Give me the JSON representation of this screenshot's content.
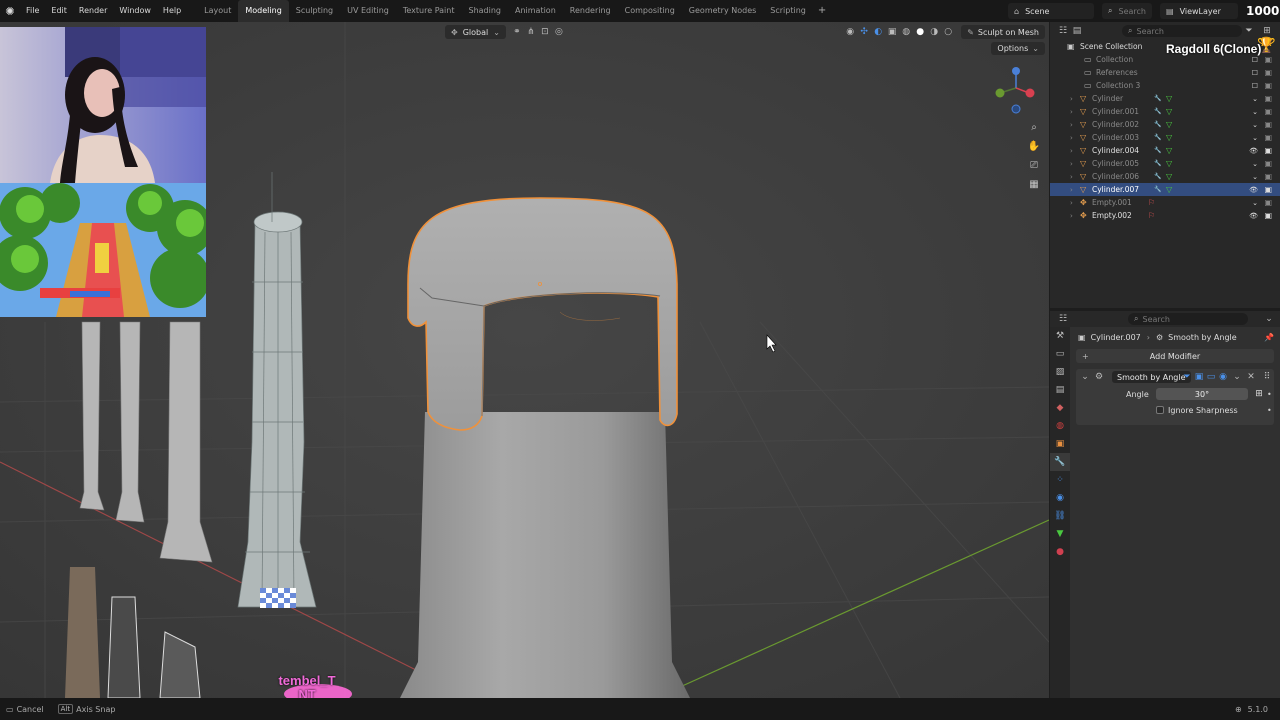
{
  "menu": {
    "items": [
      "File",
      "Edit",
      "Render",
      "Window",
      "Help"
    ]
  },
  "workspaces": {
    "tabs": [
      "Layout",
      "Modeling",
      "Sculpting",
      "UV Editing",
      "Texture Paint",
      "Shading",
      "Animation",
      "Rendering",
      "Compositing",
      "Geometry Nodes",
      "Scripting"
    ],
    "active": "Modeling"
  },
  "topright": {
    "scene": "Scene",
    "search_placeholder": "Search",
    "view_layer": "ViewLayer",
    "counter": "1000"
  },
  "viewport": {
    "transform_orientation": "Global",
    "sculpt_button": "Sculpt on Mesh",
    "options": "Options",
    "overlay_text": "tembel_T\nNT"
  },
  "outliner": {
    "header": "Scene Collection",
    "search_placeholder": "Search",
    "overlay_name": "Ragdoll 6(Clone)",
    "rows": [
      {
        "label": "Collection",
        "indent": 1,
        "kind": "collection",
        "dim": true,
        "has_arrow": false
      },
      {
        "label": "References",
        "indent": 1,
        "kind": "collection",
        "dim": true,
        "has_arrow": false
      },
      {
        "label": "Collection 3",
        "indent": 1,
        "kind": "collection",
        "dim": true,
        "has_arrow": false
      },
      {
        "label": "Cylinder",
        "indent": 2,
        "kind": "mesh",
        "dim": true,
        "has_arrow": true
      },
      {
        "label": "Cylinder.001",
        "indent": 2,
        "kind": "mesh",
        "dim": true,
        "has_arrow": true
      },
      {
        "label": "Cylinder.002",
        "indent": 2,
        "kind": "mesh",
        "dim": true,
        "has_arrow": true
      },
      {
        "label": "Cylinder.003",
        "indent": 2,
        "kind": "mesh",
        "dim": true,
        "has_arrow": true
      },
      {
        "label": "Cylinder.004",
        "indent": 2,
        "kind": "mesh",
        "dim": false,
        "has_arrow": true
      },
      {
        "label": "Cylinder.005",
        "indent": 2,
        "kind": "mesh",
        "dim": true,
        "has_arrow": true
      },
      {
        "label": "Cylinder.006",
        "indent": 2,
        "kind": "mesh",
        "dim": true,
        "has_arrow": true
      },
      {
        "label": "Cylinder.007",
        "indent": 2,
        "kind": "mesh",
        "dim": false,
        "has_arrow": true,
        "selected": true
      },
      {
        "label": "Empty.001",
        "indent": 2,
        "kind": "empty",
        "dim": true,
        "has_arrow": true
      },
      {
        "label": "Empty.002",
        "indent": 2,
        "kind": "empty",
        "dim": false,
        "has_arrow": true
      }
    ]
  },
  "properties": {
    "search_placeholder": "Search",
    "object_name": "Cylinder.007",
    "modifier_crumb": "Smooth by Angle",
    "add_modifier": "Add Modifier",
    "modifier": {
      "name": "Smooth by Angle",
      "angle_label": "Angle",
      "angle_value": "30°",
      "ignore_sharpness_label": "Ignore Sharpness"
    }
  },
  "status": {
    "cancel": "Cancel",
    "alt_key": "Alt",
    "axis_snap": "Axis Snap",
    "version": "5.1.0"
  },
  "colors": {
    "selection_orange": "#f0913a",
    "selected_row": "#334d80",
    "accent_blue": "#4772b3",
    "overlay_pink": "#f06ad8"
  }
}
